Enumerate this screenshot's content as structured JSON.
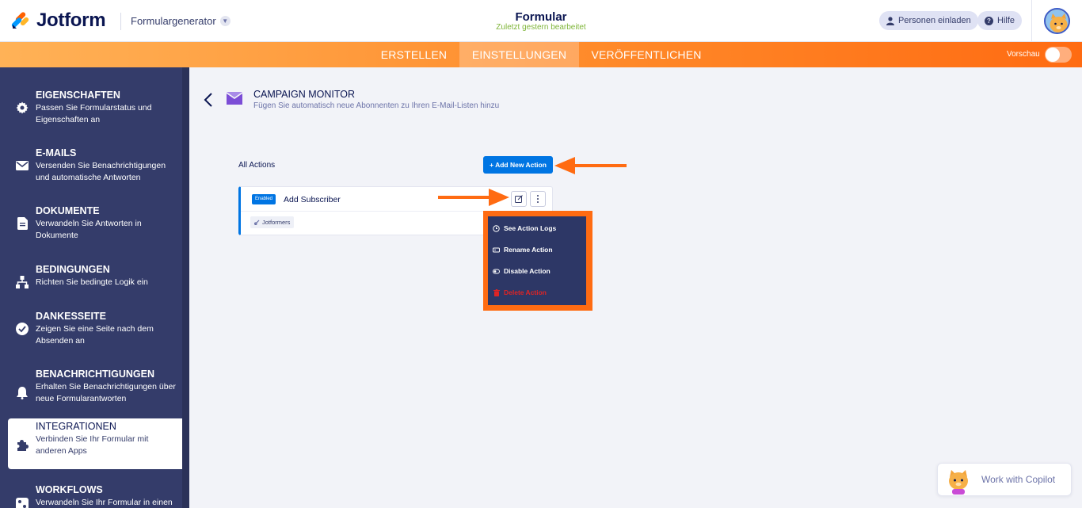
{
  "header": {
    "logo_text": "Jotform",
    "app_switcher": "Formulargenerator",
    "form_title": "Formular",
    "form_subtitle": "Zuletzt gestern bearbeitet",
    "invite_label": "Personen einladen",
    "help_label": "Hilfe"
  },
  "nav": {
    "tabs": [
      {
        "label": "ERSTELLEN"
      },
      {
        "label": "EINSTELLUNGEN"
      },
      {
        "label": "VERÖFFENTLICHEN"
      }
    ],
    "active_tab": "EINSTELLUNGEN",
    "preview_label": "Vorschau",
    "preview_enabled": false
  },
  "sidebar": {
    "items": [
      {
        "title": "EIGENSCHAFTEN",
        "desc": "Passen Sie Formularstatus und Eigenschaften an",
        "icon": "gear-icon"
      },
      {
        "title": "E-MAILS",
        "desc": "Versenden Sie Benachrichtigungen und automatische Antworten",
        "icon": "envelope-icon"
      },
      {
        "title": "DOKUMENTE",
        "desc": "Verwandeln Sie Antworten in Dokumente",
        "icon": "document-icon"
      },
      {
        "title": "BEDINGUNGEN",
        "desc": "Richten Sie bedingte Logik ein",
        "icon": "hierarchy-icon"
      },
      {
        "title": "DANKESSEITE",
        "desc": "Zeigen Sie eine Seite nach dem Absenden an",
        "icon": "check-circle-icon"
      },
      {
        "title": "BENACHRICHTIGUNGEN",
        "desc": "Erhalten Sie Benachrichtigungen über neue Formularantworten",
        "icon": "bell-icon"
      },
      {
        "title": "INTEGRATIONEN",
        "desc": "Verbinden Sie Ihr Formular mit anderen Apps",
        "icon": "puzzle-icon"
      },
      {
        "title": "WORKFLOWS",
        "desc": "Verwandeln Sie Ihr Formular in einen",
        "icon": "workflow-icon"
      }
    ],
    "active_item": "INTEGRATIONEN"
  },
  "integration": {
    "title": "CAMPAIGN MONITOR",
    "subtitle": "Fügen Sie automatisch neue Abonnenten zu Ihren E-Mail-Listen hinzu",
    "all_actions_label": "All Actions",
    "add_action_label": "+ Add New Action"
  },
  "action_card": {
    "status_badge": "Enabled",
    "name": "Add Subscriber",
    "tag": "Jotformers"
  },
  "action_menu": {
    "items": [
      {
        "label": "See Action Logs",
        "icon": "history-icon"
      },
      {
        "label": "Rename Action",
        "icon": "rename-icon"
      },
      {
        "label": "Disable Action",
        "icon": "disable-icon"
      },
      {
        "label": "Delete Action",
        "icon": "trash-icon"
      }
    ]
  },
  "copilot": {
    "label": "Work with Copilot"
  },
  "colors": {
    "navy": "#343c6a",
    "primary_blue": "#0075e3",
    "orange": "#ff6b12",
    "danger": "#e02424",
    "success_green": "#7fb539"
  }
}
